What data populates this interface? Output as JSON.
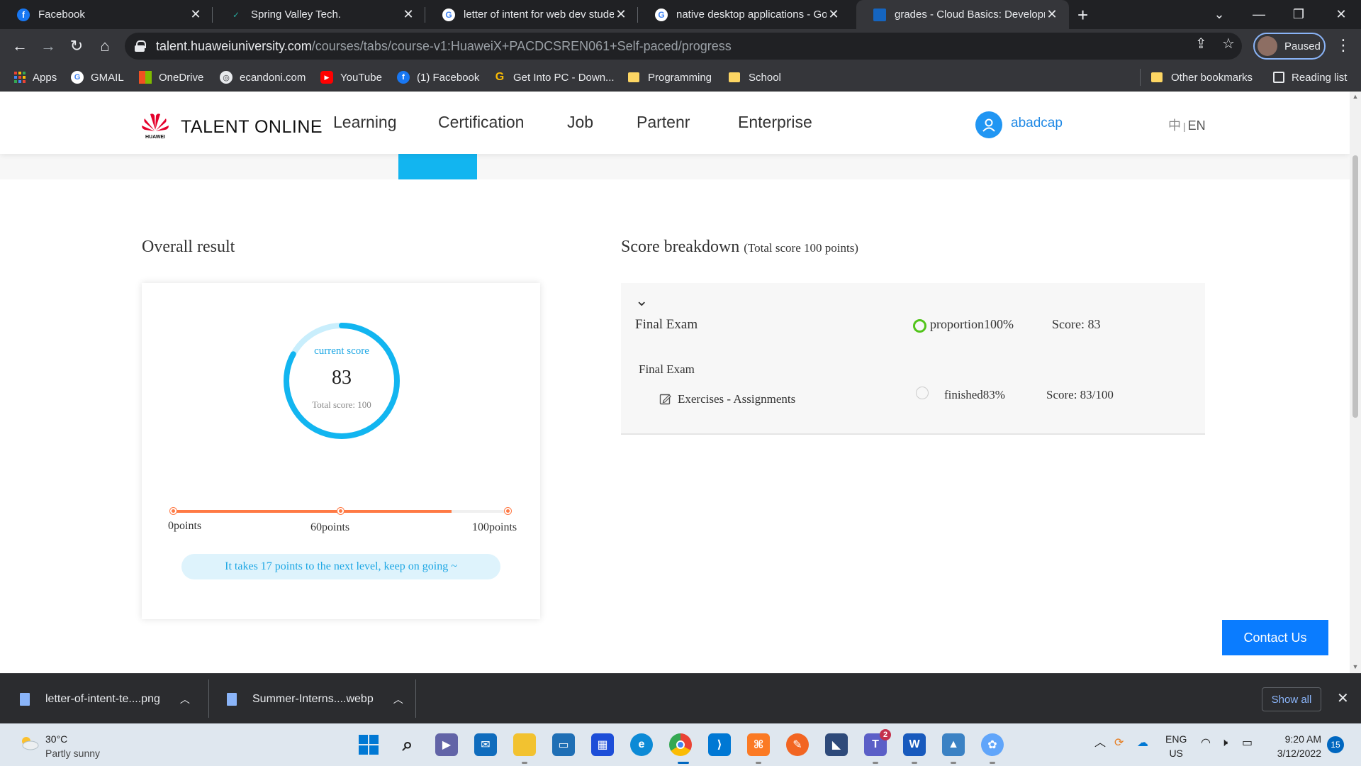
{
  "browser": {
    "tabs": [
      {
        "title": "Facebook",
        "icon": "facebook-icon",
        "color": "#1877f2",
        "glyph": "f"
      },
      {
        "title": "Spring Valley Tech.",
        "icon": "spring-valley-icon",
        "color": "#2e7d32",
        "glyph": "✓"
      },
      {
        "title": "letter of intent for web dev stude",
        "icon": "google-icon",
        "color": "#ffffff",
        "glyph": "G"
      },
      {
        "title": "native desktop applications - Goo",
        "icon": "google-icon",
        "color": "#ffffff",
        "glyph": "G"
      },
      {
        "title": "grades - Cloud Basics: Developm",
        "icon": "huawei-icon",
        "color": "#1565c0",
        "glyph": "■"
      }
    ],
    "url_host": "talent.huaweiuniversity.com",
    "url_path": "/courses/tabs/course-v1:HuaweiX+PACDCSREN061+Self-paced/progress",
    "profile_label": "Paused",
    "bookmarks": [
      {
        "label": "Apps",
        "type": "apps"
      },
      {
        "label": "GMAIL",
        "type": "google"
      },
      {
        "label": "OneDrive",
        "type": "windows"
      },
      {
        "label": "ecandoni.com",
        "type": "globe"
      },
      {
        "label": "YouTube",
        "type": "youtube"
      },
      {
        "label": "(1) Facebook",
        "type": "facebook"
      },
      {
        "label": "Get Into PC - Down...",
        "type": "getintopc"
      },
      {
        "label": "Programming",
        "type": "folder"
      },
      {
        "label": "School",
        "type": "folder"
      },
      {
        "label": "Other bookmarks",
        "type": "folder"
      },
      {
        "label": "Reading list",
        "type": "reading"
      }
    ]
  },
  "site": {
    "brand": "TALENT ONLINE",
    "logo_caption": "HUAWEI",
    "nav": [
      "Learning",
      "Certification",
      "Job",
      "Partenr",
      "Enterprise"
    ],
    "username": "abadcap",
    "lang_zh": "中",
    "lang_sep": "|",
    "lang_en": "EN",
    "accent": "#12b5f0"
  },
  "overall": {
    "title": "Overall result",
    "current_label": "current score",
    "score": "83",
    "total_label": "Total score: 100",
    "score_fraction": 0.83,
    "progress_fraction": 0.83,
    "ticks": [
      "0points",
      "60points",
      "100points"
    ],
    "next_level": "It takes 17 points to the next level, keep on going ~"
  },
  "breakdown": {
    "title": "Score breakdown",
    "subtitle": "(Total score 100 points)",
    "chevron": "⌄",
    "group_name": "Final Exam",
    "proportion": "proportion100%",
    "score": "Score: 83",
    "sub_heading": "Final Exam",
    "item_name": "Exercises - Assignments",
    "item_status": "finished83%",
    "item_score": "Score: 83/100"
  },
  "contact_label": "Contact Us",
  "downloads": {
    "items": [
      "letter-of-intent-te....png",
      "Summer-Interns....webp"
    ],
    "show_all": "Show all"
  },
  "taskbar": {
    "temperature": "30°C",
    "weather": "Partly sunny",
    "lang": "ENG",
    "region": "US",
    "time": "9:20 AM",
    "date": "3/12/2022",
    "notifications": "15",
    "teams_badge": "2"
  }
}
